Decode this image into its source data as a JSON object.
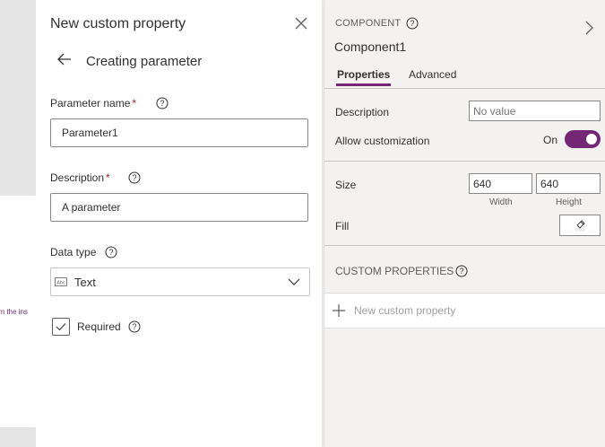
{
  "canvas": {
    "snippet": "om the ins"
  },
  "dialog": {
    "title": "New custom property",
    "subtitle": "Creating parameter",
    "param_name_label": "Parameter name",
    "param_name_value": "Parameter1",
    "description_label": "Description",
    "description_value": "A parameter",
    "required_mark": "*",
    "data_type_label": "Data type",
    "data_type_value": "Text",
    "required_label": "Required"
  },
  "props": {
    "section_label": "COMPONENT",
    "component_name": "Component1",
    "tabs": [
      {
        "label": "Properties"
      },
      {
        "label": "Advanced"
      }
    ],
    "description_label": "Description",
    "description_placeholder": "No value",
    "allow_custom_label": "Allow customization",
    "allow_custom_state": "On",
    "size_label": "Size",
    "width_value": "640",
    "height_value": "640",
    "width_caption": "Width",
    "height_caption": "Height",
    "fill_label": "Fill",
    "custom_props_header": "CUSTOM PROPERTIES",
    "new_custom_property_label": "New custom property"
  },
  "colors": {
    "accent": "#742774",
    "pane_bg": "#f3f2f1",
    "required": "#a4262c"
  },
  "icons": [
    "close-icon",
    "back-arrow-icon",
    "help-icon",
    "text-type-icon",
    "chevron-down-icon",
    "check-icon",
    "chevron-right-icon",
    "color-picker-icon",
    "plus-icon"
  ]
}
